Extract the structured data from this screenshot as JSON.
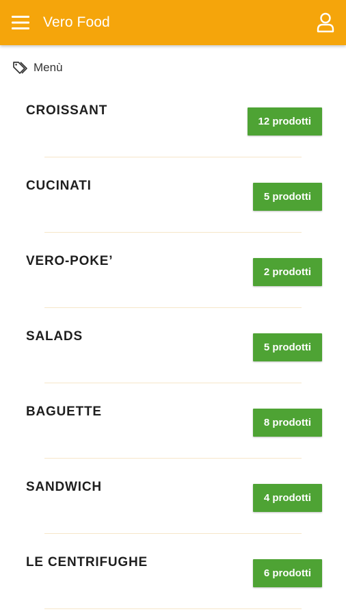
{
  "app": {
    "title": "Vero Food",
    "brand_color": "#f5a50b",
    "badge_color": "#4ea334",
    "menu_icon": "hamburger-menu-icon",
    "user_icon": "user-icon"
  },
  "breadcrumb": {
    "icon": "tag-icon",
    "label": "Menù"
  },
  "categories": [
    {
      "name": "CROISSANT",
      "count_label": "12 prodotti"
    },
    {
      "name": "CUCINATI",
      "count_label": "5 prodotti"
    },
    {
      "name": "VERO-POKE’",
      "count_label": "2 prodotti"
    },
    {
      "name": "SALADS",
      "count_label": "5 prodotti"
    },
    {
      "name": "BAGUETTE",
      "count_label": "8 prodotti"
    },
    {
      "name": "SANDWICH",
      "count_label": "4 prodotti"
    },
    {
      "name": "LE CENTRIFUGHE",
      "count_label": "6 prodotti"
    }
  ]
}
